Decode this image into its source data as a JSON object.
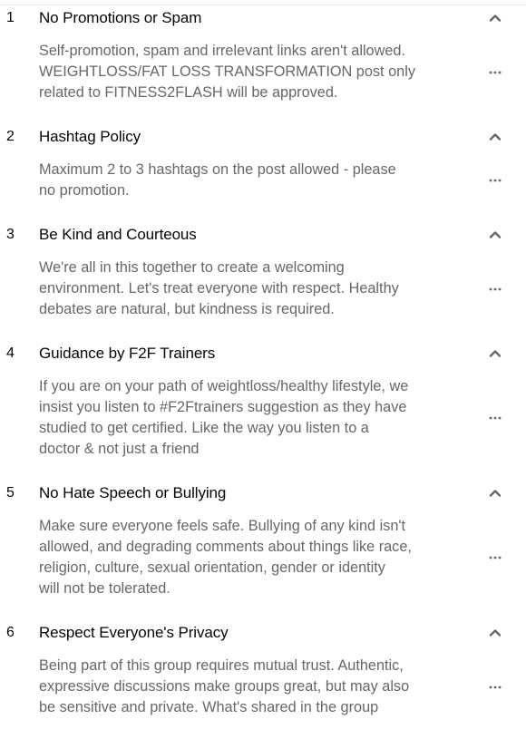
{
  "icons": {
    "collapse": "chevron-up-icon",
    "more": "more-horizontal-icon"
  },
  "rules": [
    {
      "number": "1",
      "title": "No Promotions or Spam",
      "lines": [
        "Self-promotion, spam and irrelevant links aren't allowed.",
        "WEIGHTLOSS/FAT LOSS TRANSFORMATION post only",
        "related to FITNESS2FLASH will be approved."
      ]
    },
    {
      "number": "2",
      "title": "Hashtag Policy",
      "lines": [
        "Maximum 2 to 3 hashtags on the post allowed - please",
        "no promotion."
      ]
    },
    {
      "number": "3",
      "title": "Be Kind and Courteous",
      "lines": [
        "We're all in this together to create a welcoming",
        "environment. Let's treat everyone with respect. Healthy",
        "debates are natural, but kindness is required."
      ]
    },
    {
      "number": "4",
      "title": "Guidance by F2F Trainers",
      "lines": [
        "If you are on your path of weightloss/healthy lifestyle, we",
        "insist you listen to #F2Ftrainers suggestion as they have",
        "studied to get certified. Like the way you listen to a",
        "doctor & not just a friend"
      ]
    },
    {
      "number": "5",
      "title": "No Hate Speech or Bullying",
      "lines": [
        "Make sure everyone feels safe. Bullying of any kind isn't",
        "allowed, and degrading comments about things like race,",
        "religion, culture, sexual orientation, gender or identity",
        "will not be tolerated."
      ]
    },
    {
      "number": "6",
      "title": "Respect Everyone's Privacy",
      "lines": [
        "Being part of this group requires mutual trust. Authentic,",
        "expressive discussions make groups great, but may also",
        "be sensitive and private. What's shared in the group"
      ]
    }
  ]
}
